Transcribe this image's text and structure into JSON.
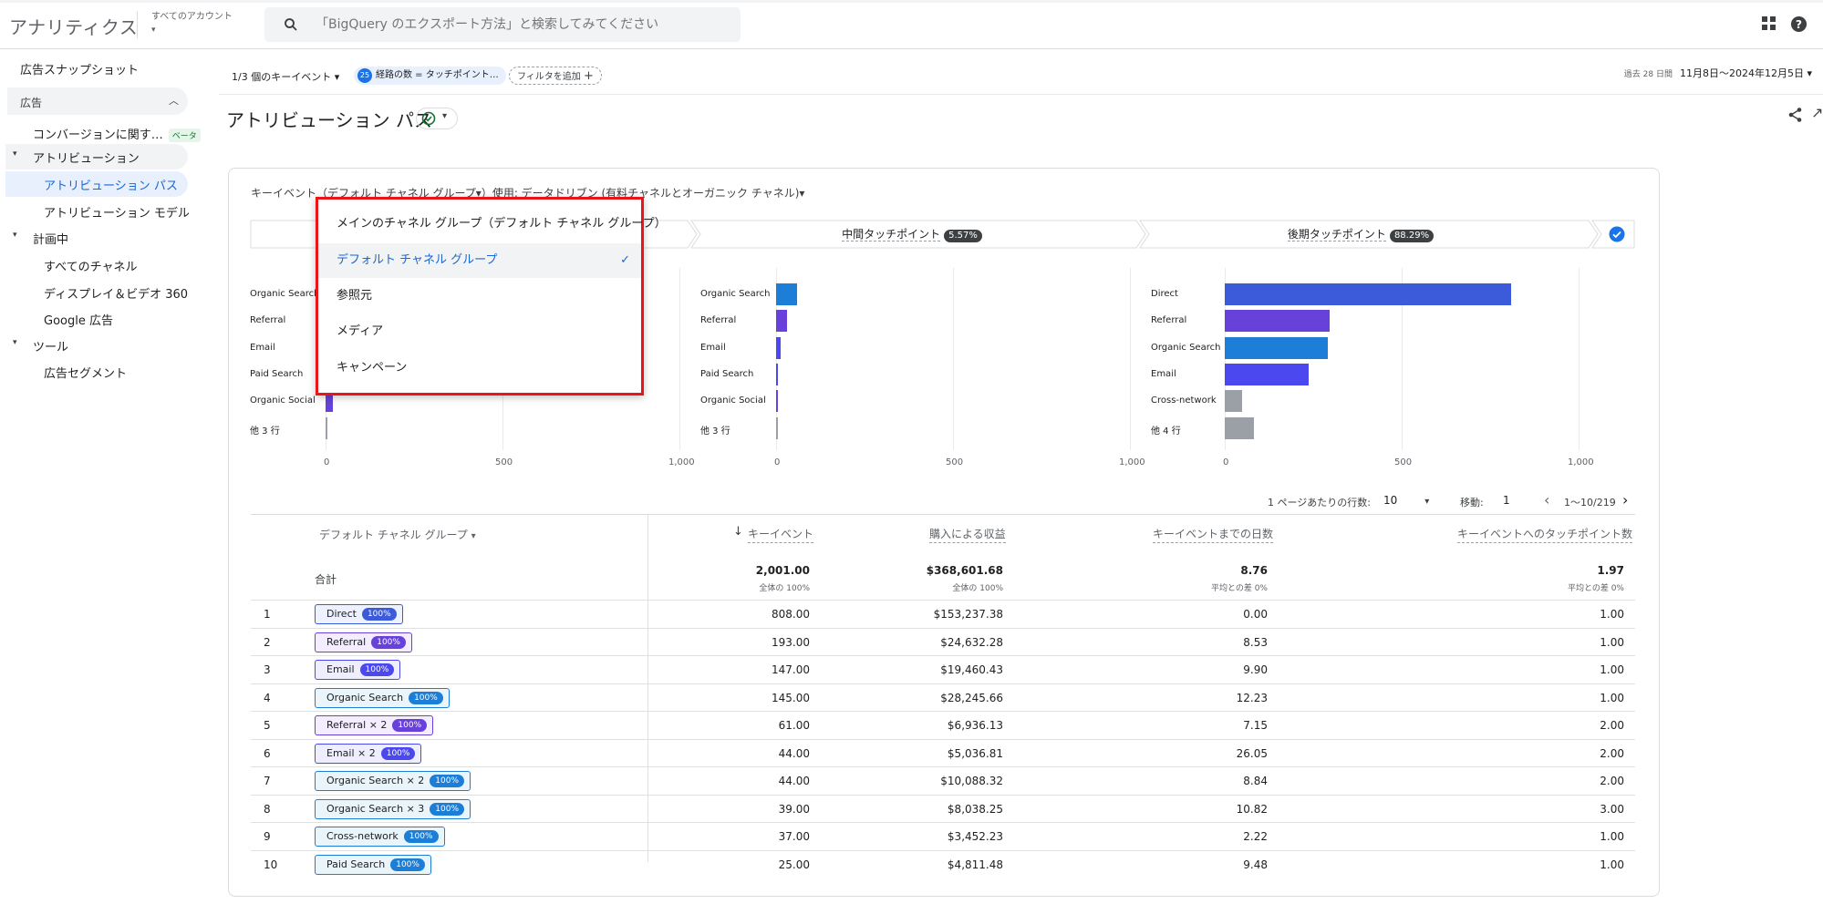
{
  "app": {
    "title": "アナリティクス",
    "account_label": "すべてのアカウント"
  },
  "search": {
    "placeholder": "「BigQuery のエクスポート方法」と検索してみてください"
  },
  "sidebar": {
    "items": [
      {
        "label": "広告スナップショット"
      },
      {
        "label": "広告"
      },
      {
        "label": "コンバージョンに関す…",
        "badge": "ベータ"
      },
      {
        "label": "アトリビューション"
      },
      {
        "label": "アトリビューション パス"
      },
      {
        "label": "アトリビューション モデル"
      },
      {
        "label": "計画中"
      },
      {
        "label": "すべてのチャネル"
      },
      {
        "label": "ディスプレイ＆ビデオ 360"
      },
      {
        "label": "Google 広告"
      },
      {
        "label": "ツール"
      },
      {
        "label": "広告セグメント"
      }
    ]
  },
  "filterbar": {
    "key_events": "1/3 個のキーイベント",
    "chip1": "経路の数 = タッチポイント…",
    "chip1_icon": "25",
    "add_filter": "フィルタを追加",
    "date_prefix": "過去 28 日間",
    "date_range": "11月8日～2024年12月5日"
  },
  "page": {
    "title": "アトリビューション パス"
  },
  "card": {
    "subtitle_prefix": "キーイベント（デフォルト チャネル グループ▾）使用: データドリブン (有料チャネルとオーガニック チャネル)▾",
    "segments": [
      {
        "label": "中間タッチポイント",
        "pct": "5.57%"
      },
      {
        "label": "後期タッチポイント",
        "pct": "88.29%"
      }
    ]
  },
  "chart_data": [
    {
      "type": "bar",
      "title": "",
      "categories": [
        "Organic Search",
        "Referral",
        "Email",
        "Paid Search",
        "Organic Social",
        "他 3 行"
      ],
      "values": [
        8,
        6,
        5,
        3,
        20,
        2
      ],
      "xlim": [
        0,
        1000
      ],
      "xticks": [
        "0",
        "500",
        "1,000"
      ]
    },
    {
      "type": "bar",
      "title": "中間タッチポイント",
      "categories": [
        "Organic Search",
        "Referral",
        "Email",
        "Paid Search",
        "Organic Social",
        "他 3 行"
      ],
      "values": [
        58,
        30,
        12,
        3,
        3,
        3
      ],
      "xlim": [
        0,
        1000
      ],
      "xticks": [
        "0",
        "500",
        "1,000"
      ]
    },
    {
      "type": "bar",
      "title": "後期タッチポイント",
      "categories": [
        "Direct",
        "Referral",
        "Organic Search",
        "Email",
        "Cross-network",
        "他 4 行"
      ],
      "values": [
        808,
        296,
        290,
        236,
        50,
        82
      ],
      "xlim": [
        0,
        1000
      ],
      "xticks": [
        "0",
        "500",
        "1,000"
      ],
      "colors": [
        "#3b5bdb",
        "#6741d9",
        "#1c7ed6",
        "#4c48f0",
        "#9aa0a6",
        "#9aa0a6"
      ]
    }
  ],
  "pagination": {
    "rows_per_page_label": "1 ページあたりの行数:",
    "rows_per_page": "10",
    "goto_label": "移動:",
    "goto_value": "1",
    "range": "1～10/219"
  },
  "table": {
    "dim_header": "デフォルト チャネル グループ",
    "headers": [
      "キーイベント",
      "購入による収益",
      "キーイベントまでの日数",
      "キーイベントへのタッチポイント数"
    ],
    "total_label": "合計",
    "totals": [
      "2,001.00",
      "$368,601.68",
      "8.76",
      "1.97"
    ],
    "totals_sub": [
      "全体の 100%",
      "全体の 100%",
      "平均との差 0%",
      "平均との差 0%"
    ],
    "rows": [
      {
        "idx": "1",
        "path": "Direct",
        "badge": "100%",
        "color": "#3b5bdb",
        "bg": "#eef1ff",
        "v": [
          "808.00",
          "$153,237.38",
          "0.00",
          "1.00"
        ]
      },
      {
        "idx": "2",
        "path": "Referral",
        "badge": "100%",
        "color": "#6741d9",
        "bg": "#f3edff",
        "v": [
          "193.00",
          "$24,632.28",
          "8.53",
          "1.00"
        ]
      },
      {
        "idx": "3",
        "path": "Email",
        "badge": "100%",
        "color": "#4c48f0",
        "bg": "#efeeff",
        "v": [
          "147.00",
          "$19,460.43",
          "9.90",
          "1.00"
        ]
      },
      {
        "idx": "4",
        "path": "Organic Search",
        "badge": "100%",
        "color": "#1c7ed6",
        "bg": "#eaf4fb",
        "v": [
          "145.00",
          "$28,245.66",
          "12.23",
          "1.00"
        ]
      },
      {
        "idx": "5",
        "path": "Referral × 2",
        "badge": "100%",
        "color": "#6741d9",
        "bg": "#f3edff",
        "v": [
          "61.00",
          "$6,936.13",
          "7.15",
          "2.00"
        ]
      },
      {
        "idx": "6",
        "path": "Email × 2",
        "badge": "100%",
        "color": "#4c48f0",
        "bg": "#efeeff",
        "v": [
          "44.00",
          "$5,036.81",
          "26.05",
          "2.00"
        ]
      },
      {
        "idx": "7",
        "path": "Organic Search × 2",
        "badge": "100%",
        "color": "#1c7ed6",
        "bg": "#eaf4fb",
        "v": [
          "44.00",
          "$10,088.32",
          "8.84",
          "2.00"
        ]
      },
      {
        "idx": "8",
        "path": "Organic Search × 3",
        "badge": "100%",
        "color": "#1c7ed6",
        "bg": "#eaf4fb",
        "v": [
          "39.00",
          "$8,038.25",
          "10.82",
          "3.00"
        ]
      },
      {
        "idx": "9",
        "path": "Cross-network",
        "badge": "100%",
        "color": "#1c7ed6",
        "bg": "#eaf4fb",
        "v": [
          "37.00",
          "$3,452.23",
          "2.22",
          "1.00"
        ]
      },
      {
        "idx": "10",
        "path": "Paid Search",
        "badge": "100%",
        "color": "#1c7ed6",
        "bg": "#eaf4fb",
        "v": [
          "25.00",
          "$4,811.48",
          "9.48",
          "1.00"
        ]
      }
    ]
  },
  "dropdown": {
    "items": [
      {
        "label": "メインのチャネル グループ（デフォルト チャネル グループ）"
      },
      {
        "label": "デフォルト チャネル グループ",
        "selected": true
      },
      {
        "label": "参照元"
      },
      {
        "label": "メディア"
      },
      {
        "label": "キャンペーン"
      }
    ]
  },
  "colors": {
    "accent": "#1a73e8",
    "highlight": "#e8161b",
    "sidebar_selected": "#e8f0fe"
  }
}
